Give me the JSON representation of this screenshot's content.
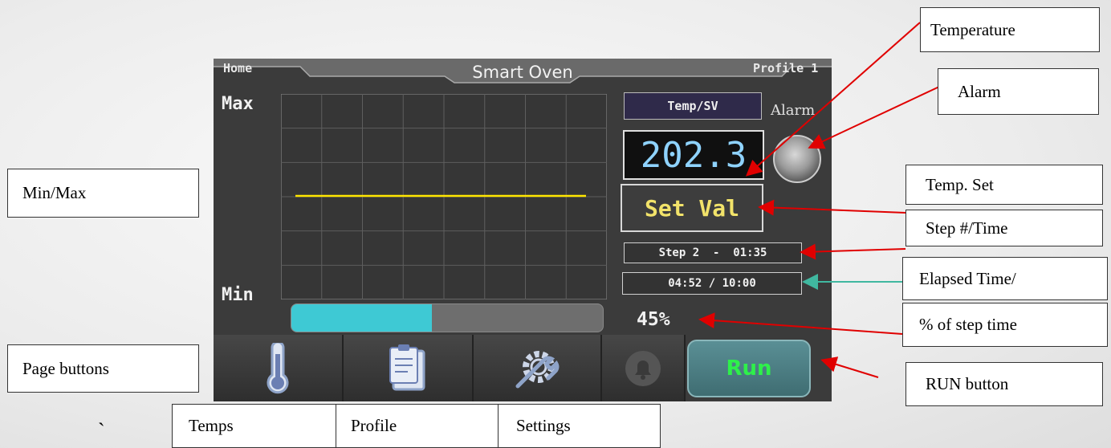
{
  "device": {
    "header": {
      "home": "Home",
      "title": "Smart Oven",
      "profile": "Profile 1"
    },
    "chart": {
      "max_label": "Max",
      "min_label": "Min"
    },
    "progress": {
      "fraction": 0.45,
      "percent_text": "45%"
    },
    "mode_label": "Temp/SV",
    "temperature": "202.3",
    "set_value": "Set Val",
    "step_time": "Step 2  -  01:35",
    "elapsed": "04:52 / 10:00",
    "alarm_label": "Alarm",
    "nav": [
      {
        "icon": "thermometer-icon"
      },
      {
        "icon": "clipboard-icon"
      },
      {
        "icon": "wrench-gear-icon"
      },
      {
        "icon": "bell-icon"
      }
    ],
    "run_label": "Run"
  },
  "callouts": {
    "temperature": "Temperature",
    "alarm": "Alarm",
    "min_max": "Min/Max",
    "temp_set": "Temp. Set",
    "step_time": "Step #/Time",
    "elapsed": "Elapsed Time/",
    "percent": "% of step time",
    "page_buttons": "Page buttons",
    "run_button": "RUN button",
    "temps": "Temps",
    "profile": "Profile",
    "settings": "Settings"
  },
  "stray_mark": "`",
  "colors": {
    "screen_bg": "#3b3b3b",
    "progress_fill": "#3ec9d4",
    "temperature_text": "#8fd3ff",
    "set_value_text": "#f2e36a",
    "chart_line": "#ffe600",
    "run_text": "#2ef04a",
    "arrow_red": "#e00000",
    "arrow_teal": "#40b8a0"
  }
}
